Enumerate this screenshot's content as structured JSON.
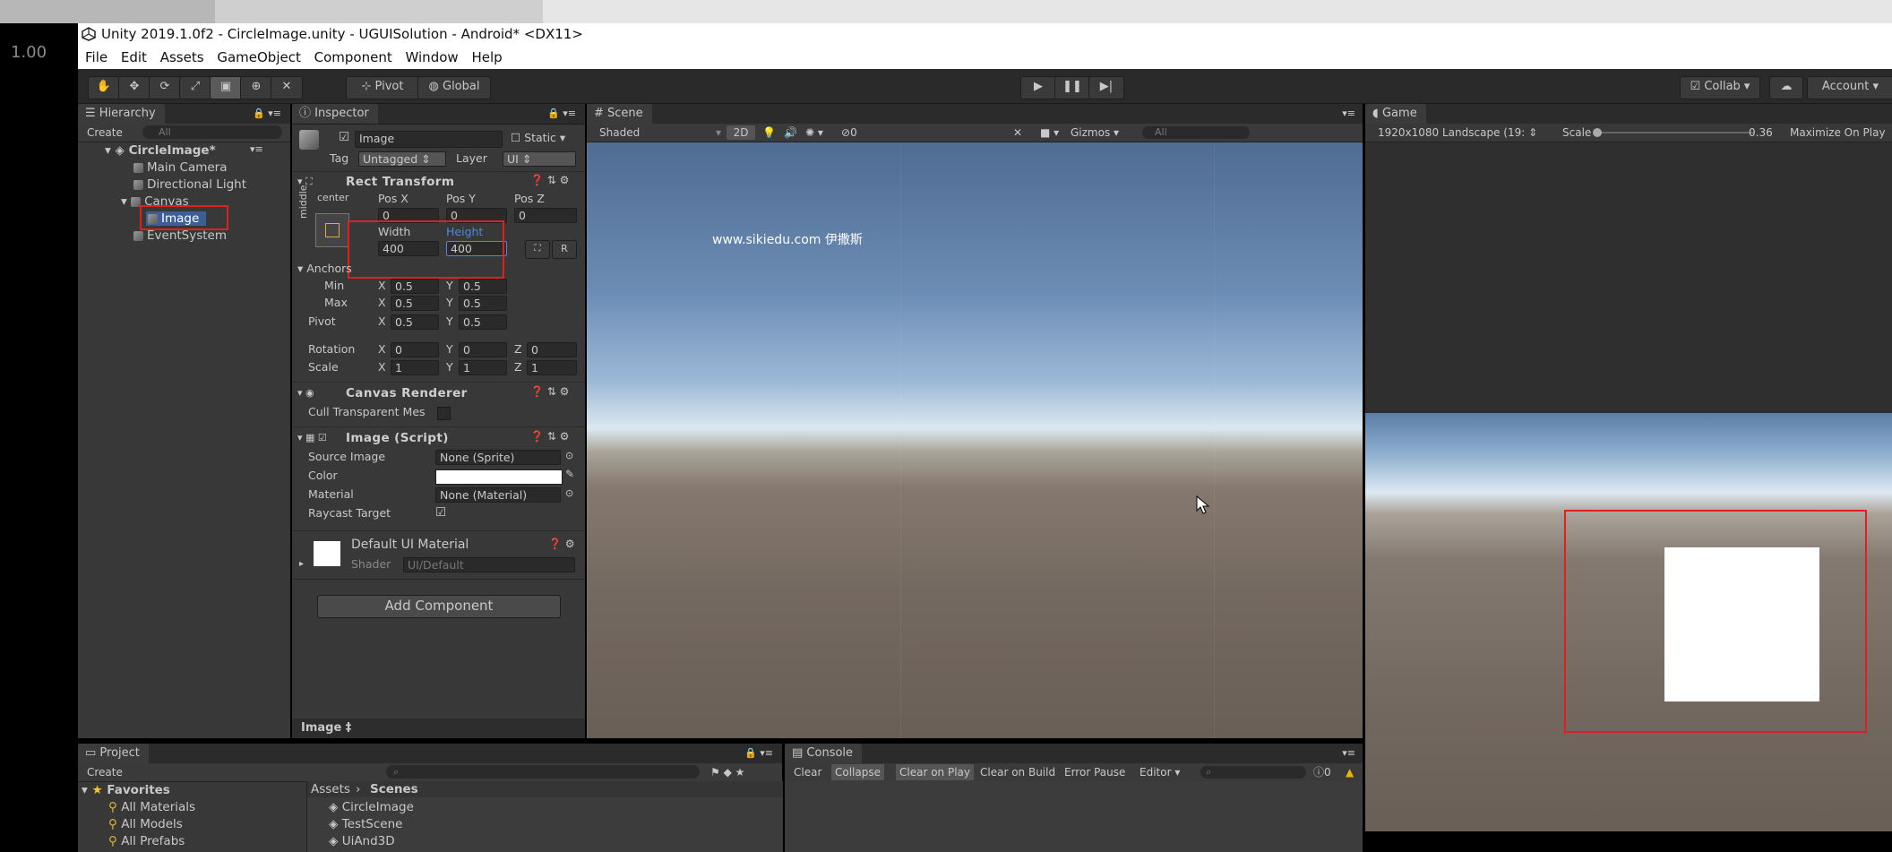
{
  "side_badge": "1.00",
  "title": "Unity 2019.1.0f2 - CircleImage.unity - UGUISolution - Android* <DX11>",
  "menu": [
    "File",
    "Edit",
    "Assets",
    "GameObject",
    "Component",
    "Window",
    "Help"
  ],
  "toolbar": {
    "pivot": "Pivot",
    "global": "Global",
    "collab": "Collab",
    "account": "Account"
  },
  "hierarchy": {
    "tab": "Hierarchy",
    "create": "Create",
    "search_placeholder": "All",
    "scene": "CircleImage*",
    "items": [
      "Main Camera",
      "Directional Light",
      "Canvas",
      "Image",
      "EventSystem"
    ]
  },
  "inspector": {
    "tab": "Inspector",
    "object_name": "Image",
    "static": "Static",
    "tag_label": "Tag",
    "tag_value": "Untagged",
    "layer_label": "Layer",
    "layer_value": "UI",
    "rect": {
      "title": "Rect Transform",
      "anchor_h": "center",
      "anchor_v": "middle",
      "posx_label": "Pos X",
      "posy_label": "Pos Y",
      "posz_label": "Pos Z",
      "posx": "0",
      "posy": "0",
      "posz": "0",
      "width_label": "Width",
      "height_label": "Height",
      "width": "400",
      "height": "400",
      "r": "R",
      "anchors": "Anchors",
      "min": "Min",
      "max": "Max",
      "pivot": "Pivot",
      "min_x": "0.5",
      "min_y": "0.5",
      "max_x": "0.5",
      "max_y": "0.5",
      "pivot_x": "0.5",
      "pivot_y": "0.5",
      "rotation": "Rotation",
      "rot_x": "0",
      "rot_y": "0",
      "rot_z": "0",
      "scale": "Scale",
      "scale_x": "1",
      "scale_y": "1",
      "scale_z": "1",
      "x": "X",
      "y": "Y",
      "z": "Z"
    },
    "canvas_renderer": {
      "title": "Canvas Renderer",
      "cull": "Cull Transparent Mes"
    },
    "image_script": {
      "title": "Image (Script)",
      "source_label": "Source Image",
      "source": "None (Sprite)",
      "color_label": "Color",
      "material_label": "Material",
      "material": "None (Material)",
      "raycast": "Raycast Target"
    },
    "material": {
      "name": "Default UI Material",
      "shader_label": "Shader",
      "shader": "UI/Default"
    },
    "add_component": "Add Component",
    "footer": "Image ‡"
  },
  "scene": {
    "tab": "Scene",
    "shaded": "Shaded",
    "btn2d": "2D",
    "gizmos": "Gizmos",
    "search_placeholder": "All",
    "zero": "0",
    "watermark": "www.sikiedu.com 伊撒斯"
  },
  "game": {
    "tab": "Game",
    "resolution": "1920x1080 Landscape (19:",
    "scale_label": "Scale",
    "scale_value": "0.36",
    "maximize": "Maximize On Play"
  },
  "project": {
    "tab": "Project",
    "create": "Create",
    "favorites": "Favorites",
    "fav_items": [
      "All Materials",
      "All Models",
      "All Prefabs"
    ],
    "crumb_root": "Assets",
    "crumb_child": "Scenes",
    "files": [
      "CircleImage",
      "TestScene",
      "UiAnd3D"
    ]
  },
  "console": {
    "tab": "Console",
    "buttons": [
      "Clear",
      "Collapse",
      "Clear on Play",
      "Clear on Build",
      "Error Pause",
      "Editor"
    ],
    "count": "0"
  },
  "colors": {
    "panel": "#383838",
    "red_annotation": "#e02020",
    "selection": "#3e5f96"
  }
}
